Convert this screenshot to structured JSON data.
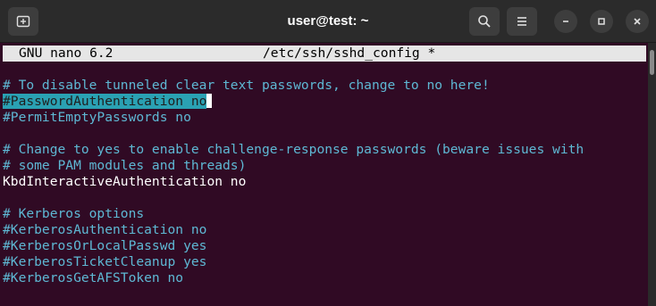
{
  "window": {
    "title": "user@test: ~",
    "icons": {
      "new_tab": "new-tab-icon",
      "search": "search-icon",
      "menu": "hamburger-menu-icon",
      "minimize": "minimize-icon",
      "maximize": "maximize-icon",
      "close": "close-icon"
    }
  },
  "nano": {
    "version": "GNU nano 6.2",
    "filename": "/etc/ssh/sshd_config *"
  },
  "lines": [
    {
      "text": "# To disable tunneled clear text passwords, change to no here!",
      "type": "comment"
    },
    {
      "text": "#PasswordAuthentication no",
      "type": "selected"
    },
    {
      "text": "#PermitEmptyPasswords no",
      "type": "comment"
    },
    {
      "text": "",
      "type": "blank"
    },
    {
      "text": "# Change to yes to enable challenge-response passwords (beware issues with",
      "type": "comment"
    },
    {
      "text": "# some PAM modules and threads)",
      "type": "comment"
    },
    {
      "text": "KbdInteractiveAuthentication no",
      "type": "normal"
    },
    {
      "text": "",
      "type": "blank"
    },
    {
      "text": "# Kerberos options",
      "type": "comment"
    },
    {
      "text": "#KerberosAuthentication no",
      "type": "comment"
    },
    {
      "text": "#KerberosOrLocalPasswd yes",
      "type": "comment"
    },
    {
      "text": "#KerberosTicketCleanup yes",
      "type": "comment"
    },
    {
      "text": "#KerberosGetAFSToken no",
      "type": "comment"
    }
  ],
  "colors": {
    "terminal_bg": "#300a24",
    "comment": "#5eb8d4",
    "selection": "#2aa1b3",
    "header_bg": "#e6e6e6"
  }
}
